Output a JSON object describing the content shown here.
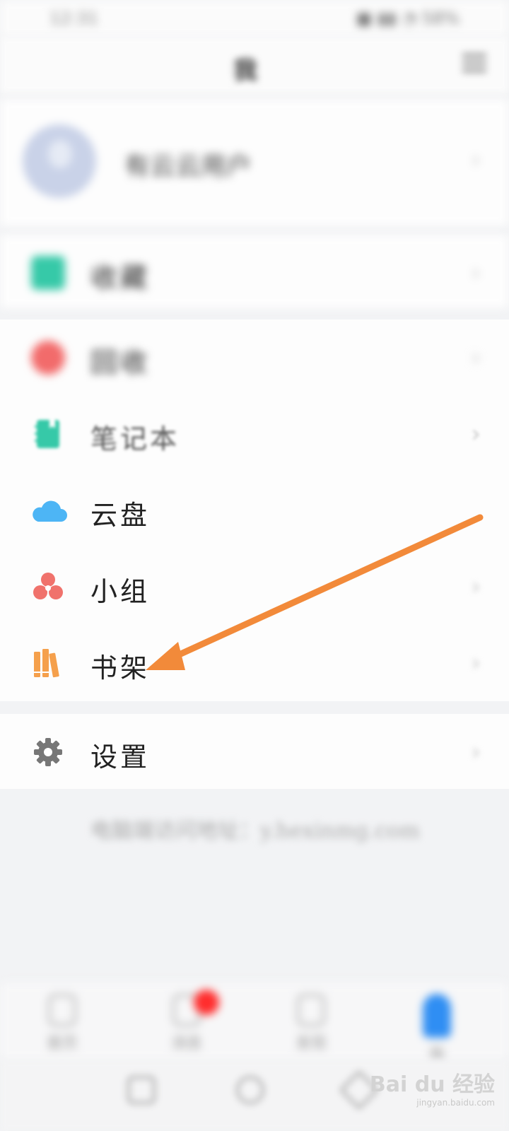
{
  "status_bar": {
    "time": "12:31",
    "right": "■ ▮▮ ◔ 58%"
  },
  "top_bar": {
    "title": "我",
    "menu_icon": "menu-icon"
  },
  "profile": {
    "name": "有云云用户"
  },
  "menu": {
    "favorites": "收藏",
    "red_item": "回收",
    "notebook": "笔记本",
    "cloud": "云盘",
    "group": "小组",
    "bookshelf": "书架",
    "settings": "设置"
  },
  "footer": {
    "text": "电脑端访问地址：y.hexinmg.com"
  },
  "bottom_nav": [
    {
      "label": "首页"
    },
    {
      "label": "消息"
    },
    {
      "label": "发现"
    },
    {
      "label": "我"
    }
  ],
  "watermark": {
    "brand": "Bai du 经验",
    "url": "jingyan.baidu.com"
  },
  "colors": {
    "arrow": "#f28a3a",
    "notebook_icon": "#36c9a8",
    "cloud_icon": "#4db5f5",
    "group_icon": "#f0726c",
    "bookshelf_icon": "#f5a04c",
    "settings_icon": "#777777"
  }
}
